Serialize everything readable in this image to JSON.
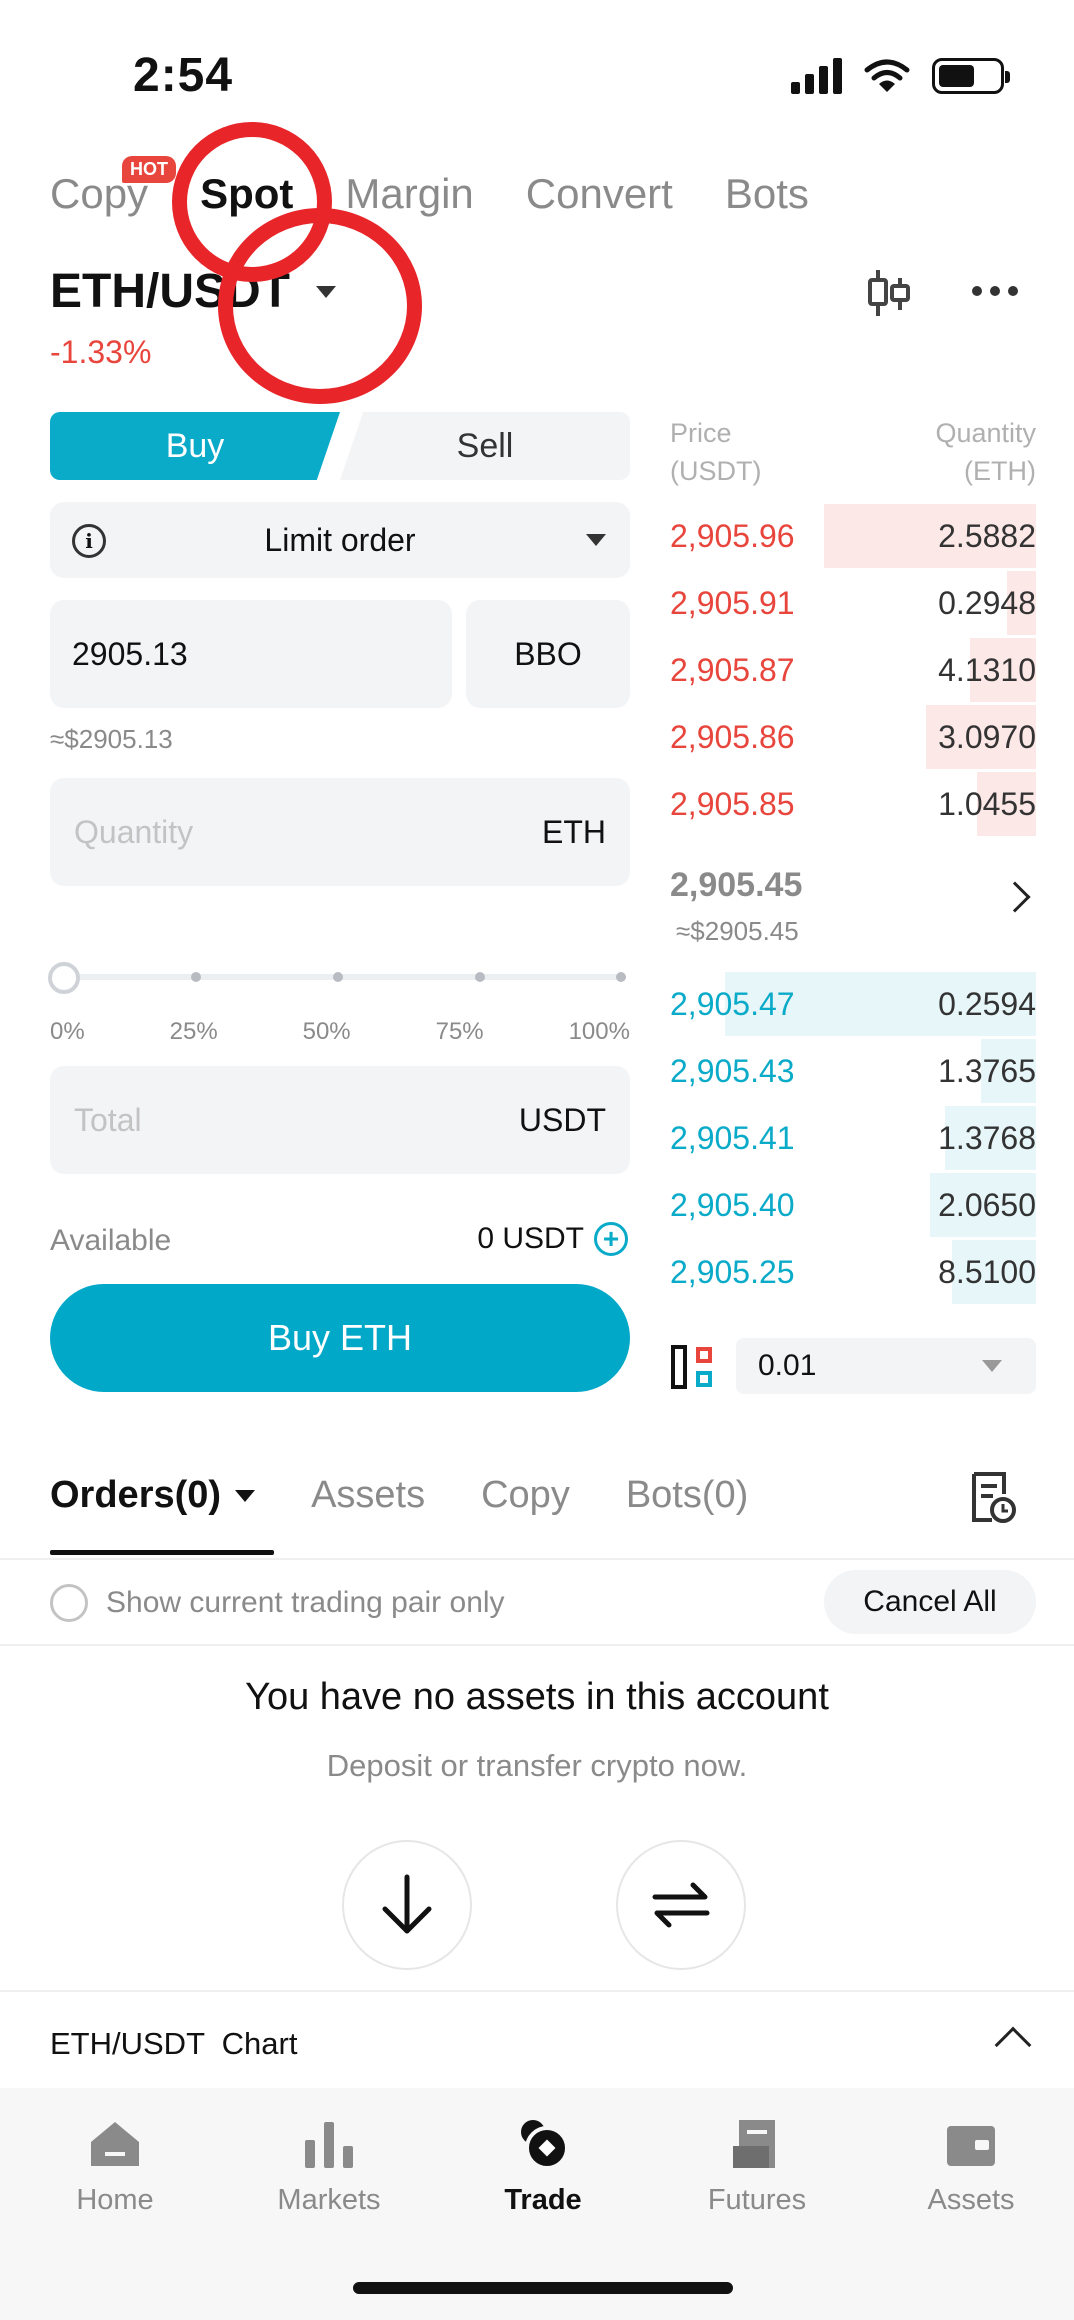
{
  "status_bar": {
    "time": "2:54"
  },
  "top_tabs": [
    {
      "label": "Copy",
      "badge": "HOT"
    },
    {
      "label": "Spot"
    },
    {
      "label": "Margin"
    },
    {
      "label": "Convert"
    },
    {
      "label": "Bots"
    }
  ],
  "pair": {
    "name": "ETH/USDT",
    "change": "-1.33%"
  },
  "trade_form": {
    "buy_label": "Buy",
    "sell_label": "Sell",
    "order_type": "Limit order",
    "price_value": "2905.13",
    "bbo_label": "BBO",
    "price_usd": "≈$2905.13",
    "quantity_placeholder": "Quantity",
    "quantity_unit": "ETH",
    "slider_percent": 0,
    "slider_labels": [
      "0%",
      "25%",
      "50%",
      "75%",
      "100%"
    ],
    "total_placeholder": "Total",
    "total_unit": "USDT",
    "available_label": "Available",
    "available_value": "0 USDT",
    "buy_button": "Buy ETH"
  },
  "order_book": {
    "price_header": "Price",
    "price_unit": "(USDT)",
    "quantity_header": "Quantity",
    "quantity_unit": "(ETH)",
    "asks": [
      {
        "price": "2,905.96",
        "qty": "2.5882",
        "depth": 0.58
      },
      {
        "price": "2,905.91",
        "qty": "0.2948",
        "depth": 0.08
      },
      {
        "price": "2,905.87",
        "qty": "4.1310",
        "depth": 0.18
      },
      {
        "price": "2,905.86",
        "qty": "3.0970",
        "depth": 0.3
      },
      {
        "price": "2,905.85",
        "qty": "1.0455",
        "depth": 0.16
      }
    ],
    "mid_price": "2,905.45",
    "mid_usd": "≈$2905.45",
    "bids": [
      {
        "price": "2,905.47",
        "qty": "0.2594",
        "depth": 0.85
      },
      {
        "price": "2,905.43",
        "qty": "1.3765",
        "depth": 0.15
      },
      {
        "price": "2,905.41",
        "qty": "1.3768",
        "depth": 0.25
      },
      {
        "price": "2,905.40",
        "qty": "2.0650",
        "depth": 0.29
      },
      {
        "price": "2,905.25",
        "qty": "8.5100",
        "depth": 0.23
      }
    ],
    "depth_value": "0.01"
  },
  "orders_tabs": [
    {
      "label": "Orders(0)"
    },
    {
      "label": "Assets"
    },
    {
      "label": "Copy"
    },
    {
      "label": "Bots(0)"
    }
  ],
  "orders_panel": {
    "show_pair_label": "Show current trading pair only",
    "cancel_all": "Cancel All",
    "empty_title": "You have no assets in this account",
    "empty_subtitle": "Deposit or transfer crypto now.",
    "chart_row": "ETH/USDT  Chart"
  },
  "bottom_nav": [
    {
      "label": "Home",
      "icon": "home-icon"
    },
    {
      "label": "Markets",
      "icon": "bar-chart-icon"
    },
    {
      "label": "Trade",
      "icon": "trade-icon",
      "active": true
    },
    {
      "label": "Futures",
      "icon": "futures-icon"
    },
    {
      "label": "Assets",
      "icon": "wallet-icon"
    }
  ],
  "colors": {
    "accent": "#0aaac9",
    "buy_button": "#02a8c8",
    "down": "#e8453c",
    "annotation": "#e82529"
  }
}
